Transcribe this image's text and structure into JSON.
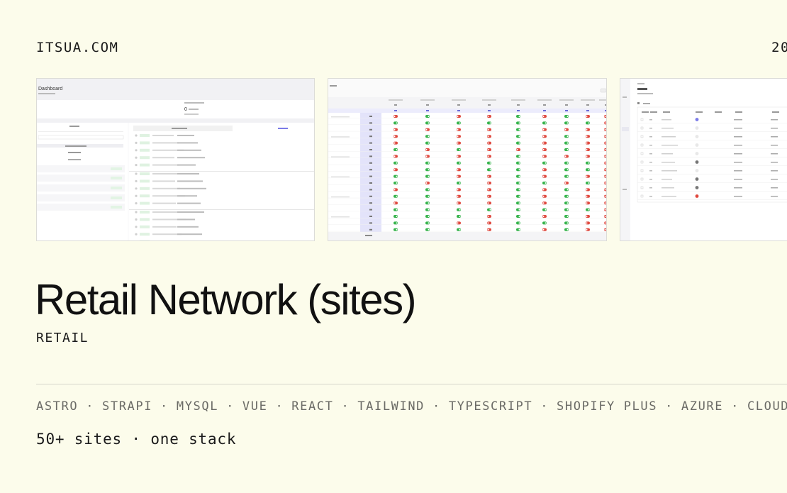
{
  "header": {
    "brand": "ITSUA.COM",
    "year": "20"
  },
  "screenshots": [
    {
      "id": "shot-dashboard",
      "title": "Dashboard"
    },
    {
      "id": "shot-matrix"
    },
    {
      "id": "shot-sites-list"
    }
  ],
  "project": {
    "title": "Retail Network (sites)",
    "category": "RETAIL"
  },
  "stack": [
    "ASTRO",
    "STRAPI",
    "MYSQL",
    "VUE",
    "REACT",
    "TAILWIND",
    "TYPESCRIPT",
    "SHOPIFY PLUS",
    "AZURE",
    "CLOUD"
  ],
  "tagline": "50+ sites · one stack",
  "colors": {
    "background": "#FCFCEB",
    "text": "#121212",
    "muted": "#6b6b66",
    "toggle_on": "#34b34a",
    "toggle_off": "#e0493f",
    "accent": "#7b7be8"
  }
}
